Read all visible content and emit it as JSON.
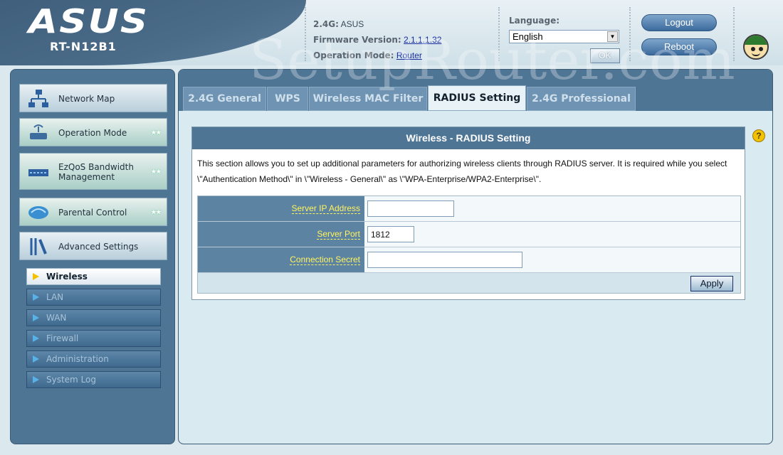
{
  "header": {
    "brand": "ASUS",
    "model": "RT-N12B1",
    "ssid_label": "2.4G:",
    "ssid_value": "ASUS",
    "firmware_label": "Firmware Version:",
    "firmware_value": "2.1.1.1.32",
    "mode_label": "Operation Mode:",
    "mode_value": "Router",
    "language_label": "Language:",
    "language_value": "English",
    "ok_label": "OK",
    "logout_label": "Logout",
    "reboot_label": "Reboot",
    "watermark": "SetupRouter.com"
  },
  "sidebar": {
    "items": [
      {
        "label": "Network Map"
      },
      {
        "label": "Operation Mode",
        "stars": "★★"
      },
      {
        "label": "EzQoS Bandwidth Management",
        "stars": "★★"
      },
      {
        "label": "Parental Control",
        "stars": "★★"
      },
      {
        "label": "Advanced Settings"
      }
    ],
    "subitems": [
      {
        "label": "Wireless"
      },
      {
        "label": "LAN"
      },
      {
        "label": "WAN"
      },
      {
        "label": "Firewall"
      },
      {
        "label": "Administration"
      },
      {
        "label": "System Log"
      }
    ]
  },
  "tabs": [
    {
      "label": "2.4G General"
    },
    {
      "label": "WPS"
    },
    {
      "label": "Wireless MAC Filter"
    },
    {
      "label": "RADIUS Setting"
    },
    {
      "label": "2.4G Professional"
    }
  ],
  "panel": {
    "title": "Wireless - RADIUS Setting",
    "description": "This section allows you to set up additional parameters for authorizing wireless clients through RADIUS server. It is required while you select \\\"Authentication Method\\\" in \\\"Wireless - General\\\" as \\\"WPA-Enterprise/WPA2-Enterprise\\\".",
    "help_label": "?",
    "fields": {
      "server_ip_label": "Server IP Address",
      "server_ip_value": "",
      "server_port_label": "Server Port",
      "server_port_value": "1812",
      "secret_label": "Connection Secret",
      "secret_value": ""
    },
    "apply_label": "Apply"
  }
}
